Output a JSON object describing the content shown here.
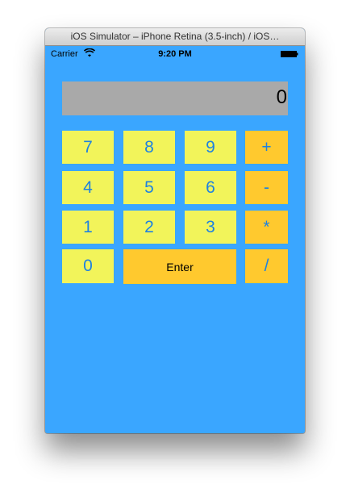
{
  "window": {
    "title": "iOS Simulator – iPhone Retina (3.5-inch) / iOS…"
  },
  "status_bar": {
    "carrier": "Carrier",
    "time": "9:20 PM",
    "wifi_icon": "wifi-icon",
    "battery_icon": "battery-icon"
  },
  "calculator": {
    "display_value": "0",
    "keys": {
      "k7": "7",
      "k8": "8",
      "k9": "9",
      "plus": "+",
      "k4": "4",
      "k5": "5",
      "k6": "6",
      "minus": "-",
      "k1": "1",
      "k2": "2",
      "k3": "3",
      "multiply": "*",
      "k0": "0",
      "enter": "Enter",
      "divide": "/"
    }
  },
  "colors": {
    "background": "#3aa6ff",
    "display": "#a9a9a9",
    "number_key": "#f2f45a",
    "operator_key": "#ffc92e",
    "key_text": "#1f82e0"
  }
}
